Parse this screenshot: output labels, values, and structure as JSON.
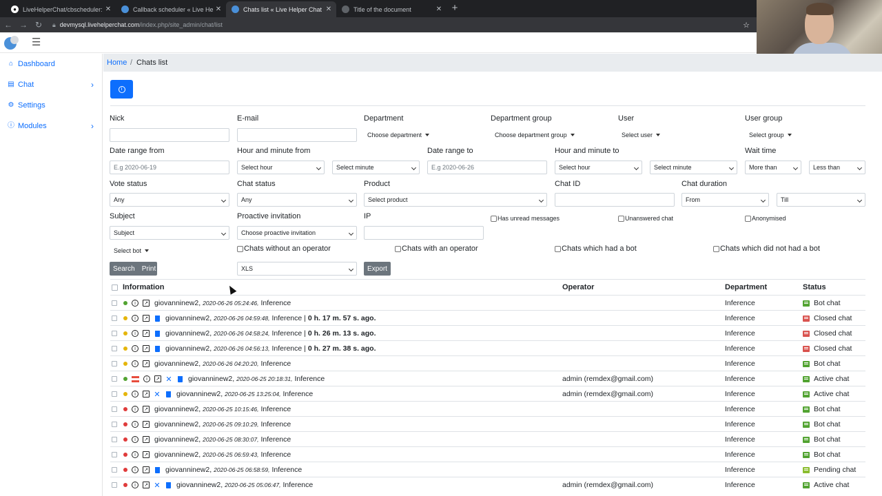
{
  "browser": {
    "tabs": [
      {
        "title": "LiveHelperChat/cbscheduler: Cal",
        "icon": "github-icon",
        "active": false
      },
      {
        "title": "Callback scheduler « Live Helper",
        "icon": "globe-icon",
        "active": false
      },
      {
        "title": "Chats list « Live Helper Chat - liv",
        "icon": "globe-icon",
        "active": true
      },
      {
        "title": "Title of the document",
        "icon": "globe-icon",
        "active": false
      }
    ],
    "url_host": "devmysql.livehelperchat.com",
    "url_path": "/index.php/site_admin/chat/list"
  },
  "sidebar": {
    "items": [
      {
        "label": "Dashboard",
        "icon": "home-icon",
        "has_children": false
      },
      {
        "label": "Chat",
        "icon": "chat-icon",
        "has_children": true
      },
      {
        "label": "Settings",
        "icon": "gear-icon",
        "has_children": false
      },
      {
        "label": "Modules",
        "icon": "info-icon",
        "has_children": true
      }
    ]
  },
  "breadcrumb": {
    "home": "Home",
    "separator": "/",
    "current": "Chats list"
  },
  "filters": {
    "nick_label": "Nick",
    "email_label": "E-mail",
    "department_label": "Department",
    "department_value": "Choose department",
    "department_group_label": "Department group",
    "department_group_value": "Choose department group",
    "user_label": "User",
    "user_value": "Select user",
    "user_group_label": "User group",
    "user_group_value": "Select group",
    "date_from_label": "Date range from",
    "date_from_placeholder": "E.g 2020-06-19",
    "hm_from_label": "Hour and minute from",
    "hour_from": "Select hour",
    "minute_from": "Select minute",
    "date_to_label": "Date range to",
    "date_to_placeholder": "E.g 2020-06-26",
    "hm_to_label": "Hour and minute to",
    "hour_to": "Select hour",
    "minute_to": "Select minute",
    "wait_time_label": "Wait time",
    "wait_more": "More than",
    "wait_less": "Less than",
    "vote_label": "Vote status",
    "vote_value": "Any",
    "chat_status_label": "Chat status",
    "chat_status_value": "Any",
    "product_label": "Product",
    "product_value": "Select product",
    "chat_id_label": "Chat ID",
    "chat_duration_label": "Chat duration",
    "duration_from": "From",
    "duration_till": "Till",
    "subject_label": "Subject",
    "subject_value": "Subject",
    "proactive_label": "Proactive invitation",
    "proactive_value": "Choose proactive invitation",
    "ip_label": "IP",
    "has_unread": "Has unread messages",
    "unanswered": "Unanswered chat",
    "anonymised": "Anonymised",
    "select_bot": "Select bot",
    "without_operator": "Chats without an operator",
    "with_operator": "Chats with an operator",
    "had_bot": "Chats which had a bot",
    "not_had_bot": "Chats which did not had a bot",
    "search_btn": "Search",
    "print_btn": "Print",
    "export_format": "XLS",
    "export_btn": "Export"
  },
  "table": {
    "headers": {
      "information": "Information",
      "operator": "Operator",
      "department": "Department",
      "status": "Status"
    },
    "status_colors": {
      "Bot chat": "#52a331",
      "Closed chat": "#d9534f",
      "Active chat": "#52a331",
      "Pending chat": "#8bbd2f"
    },
    "dot_colors": {
      "green": "#52a331",
      "yellow": "#e5b50b",
      "red": "#e03b3b"
    },
    "rows": [
      {
        "dot": "green",
        "flag": false,
        "close": false,
        "trash": false,
        "nick": "giovanninew2,",
        "date": "2020-06-26 05:24:46,",
        "dep": "Inference",
        "dur": "",
        "operator": "",
        "department": "Inference",
        "status": "Bot chat"
      },
      {
        "dot": "yellow",
        "flag": false,
        "close": false,
        "trash": true,
        "nick": "giovanninew2,",
        "date": "2020-06-26 04:59:48,",
        "dep": "Inference |",
        "dur": "0 h. 17 m. 57 s. ago.",
        "operator": "",
        "department": "Inference",
        "status": "Closed chat"
      },
      {
        "dot": "yellow",
        "flag": false,
        "close": false,
        "trash": true,
        "nick": "giovanninew2,",
        "date": "2020-06-26 04:58:24,",
        "dep": "Inference |",
        "dur": "0 h. 26 m. 13 s. ago.",
        "operator": "",
        "department": "Inference",
        "status": "Closed chat"
      },
      {
        "dot": "yellow",
        "flag": false,
        "close": false,
        "trash": true,
        "nick": "giovanninew2,",
        "date": "2020-06-26 04:56:13,",
        "dep": "Inference |",
        "dur": "0 h. 27 m. 38 s. ago.",
        "operator": "",
        "department": "Inference",
        "status": "Closed chat"
      },
      {
        "dot": "yellow",
        "flag": false,
        "close": false,
        "trash": false,
        "nick": "giovanninew2,",
        "date": "2020-06-26 04:20:20,",
        "dep": "Inference",
        "dur": "",
        "operator": "",
        "department": "Inference",
        "status": "Bot chat"
      },
      {
        "dot": "green",
        "flag": true,
        "close": true,
        "trash": true,
        "nick": "giovanninew2,",
        "date": "2020-06-25 20:18:31,",
        "dep": "Inference",
        "dur": "",
        "operator": "admin (remdex@gmail.com)",
        "department": "Inference",
        "status": "Active chat"
      },
      {
        "dot": "yellow",
        "flag": false,
        "close": true,
        "trash": true,
        "nick": "giovanninew2,",
        "date": "2020-06-25 13:25:04,",
        "dep": "Inference",
        "dur": "",
        "operator": "admin (remdex@gmail.com)",
        "department": "Inference",
        "status": "Active chat"
      },
      {
        "dot": "red",
        "flag": false,
        "close": false,
        "trash": false,
        "nick": "giovanninew2,",
        "date": "2020-06-25 10:15:46,",
        "dep": "Inference",
        "dur": "",
        "operator": "",
        "department": "Inference",
        "status": "Bot chat"
      },
      {
        "dot": "red",
        "flag": false,
        "close": false,
        "trash": false,
        "nick": "giovanninew2,",
        "date": "2020-06-25 09:10:29,",
        "dep": "Inference",
        "dur": "",
        "operator": "",
        "department": "Inference",
        "status": "Bot chat"
      },
      {
        "dot": "red",
        "flag": false,
        "close": false,
        "trash": false,
        "nick": "giovanninew2,",
        "date": "2020-06-25 08:30:07,",
        "dep": "Inference",
        "dur": "",
        "operator": "",
        "department": "Inference",
        "status": "Bot chat"
      },
      {
        "dot": "red",
        "flag": false,
        "close": false,
        "trash": false,
        "nick": "giovanninew2,",
        "date": "2020-06-25 06:59:43,",
        "dep": "Inference",
        "dur": "",
        "operator": "",
        "department": "Inference",
        "status": "Bot chat"
      },
      {
        "dot": "red",
        "flag": false,
        "close": false,
        "trash": true,
        "nick": "giovanninew2,",
        "date": "2020-06-25 06:58:59,",
        "dep": "Inference",
        "dur": "",
        "operator": "",
        "department": "Inference",
        "status": "Pending chat"
      },
      {
        "dot": "red",
        "flag": false,
        "close": true,
        "trash": true,
        "nick": "giovanninew2,",
        "date": "2020-06-25 05:06:47,",
        "dep": "Inference",
        "dur": "",
        "operator": "admin (remdex@gmail.com)",
        "department": "Inference",
        "status": "Active chat"
      }
    ]
  }
}
